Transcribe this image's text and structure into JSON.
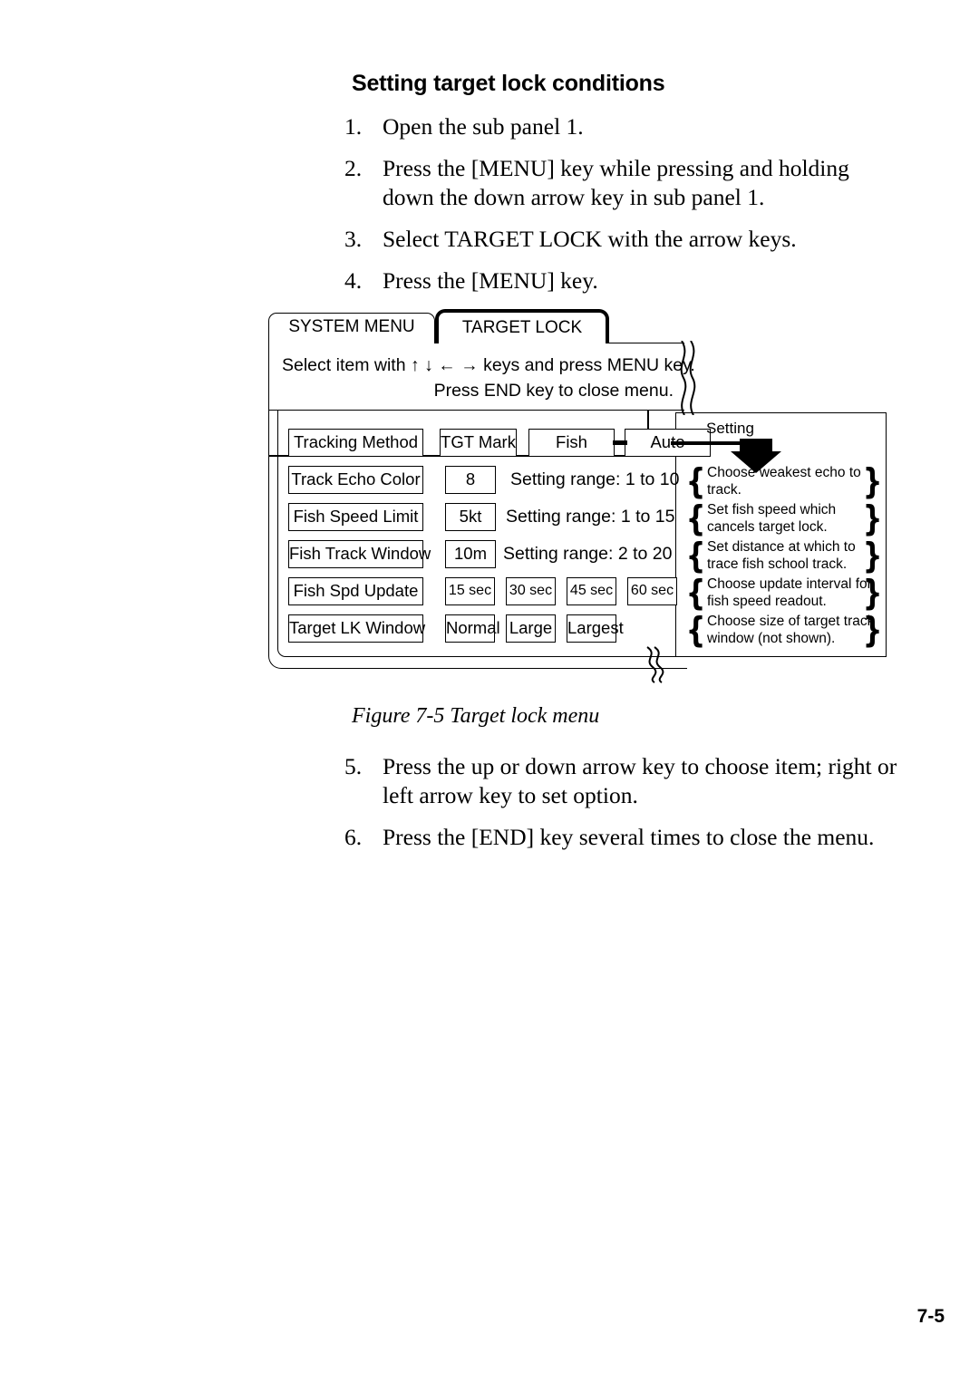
{
  "page": {
    "heading": "Setting target lock conditions",
    "figure_caption": "Figure 7-5 Target lock menu",
    "page_number": "7-5"
  },
  "steps_top": [
    {
      "num": "1.",
      "text": "Open the sub panel 1."
    },
    {
      "num": "2.",
      "text": "Press the [MENU] key while pressing and holding down the down arrow key in sub panel 1."
    },
    {
      "num": "3.",
      "text": "Select TARGET LOCK with the arrow keys."
    },
    {
      "num": "4.",
      "text": "Press the [MENU] key."
    }
  ],
  "steps_bottom": [
    {
      "num": "5.",
      "text": "Press the up or down arrow key to choose item; right or left arrow key to set option."
    },
    {
      "num": "6.",
      "text": "Press the [END] key several times to close the menu."
    }
  ],
  "menu": {
    "tabs": [
      {
        "label": "SYSTEM MENU",
        "active": false
      },
      {
        "label": "TARGET LOCK",
        "active": true
      }
    ],
    "header_lines": [
      "Select item with ↑ ↓ ← → keys and press MENU key.",
      "Press END key to close menu."
    ],
    "setting_label": "Setting",
    "rows": [
      {
        "label": "Tracking Method",
        "values": [
          "TGT Mark",
          "Fish",
          "Auto"
        ],
        "range": "",
        "annotation": ""
      },
      {
        "label": "Track Echo Color",
        "values": [
          "8"
        ],
        "range": "Setting range: 1 to 10",
        "annotation": "Choose weakest echo to track."
      },
      {
        "label": "Fish Speed Limit",
        "values": [
          "5kt"
        ],
        "range": "Setting range: 1 to 15",
        "annotation": "Set fish speed which cancels target lock."
      },
      {
        "label": "Fish Track Window",
        "values": [
          "10m"
        ],
        "range": "Setting range: 2 to 20",
        "annotation": "Set distance at which to trace fish school track."
      },
      {
        "label": "Fish Spd Update",
        "values": [
          "15 sec",
          "30 sec",
          "45 sec",
          "60 sec"
        ],
        "range": "",
        "annotation": "Choose update interval for fish speed readout."
      },
      {
        "label": "Target LK Window",
        "values": [
          "Normal",
          "Large",
          "Largest"
        ],
        "range": "",
        "annotation": "Choose size of target track window (not shown)."
      }
    ]
  }
}
